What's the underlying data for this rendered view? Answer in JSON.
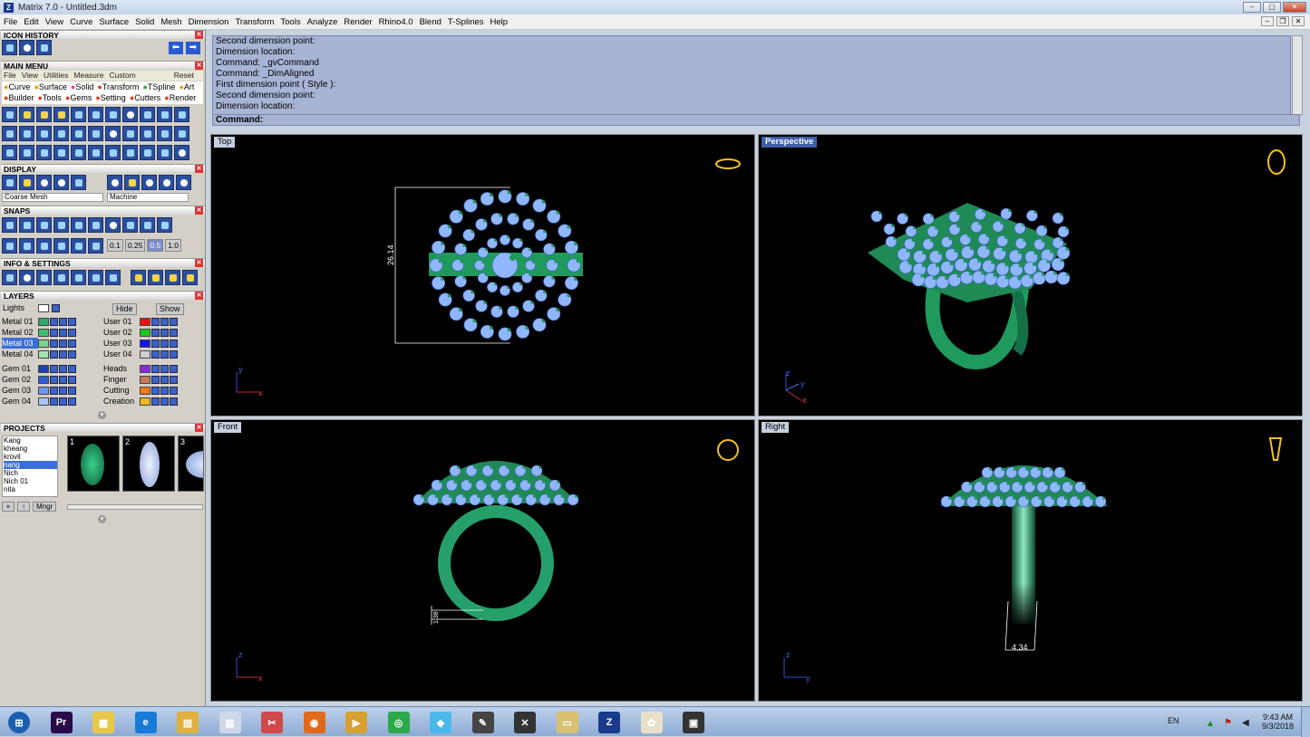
{
  "window": {
    "title": "Matrix 7.0 - Untitled.3dm",
    "app_icon": "Z"
  },
  "menu": [
    "File",
    "Edit",
    "View",
    "Curve",
    "Surface",
    "Solid",
    "Mesh",
    "Dimension",
    "Transform",
    "Tools",
    "Analyze",
    "Render",
    "Rhino4.0",
    "Blend",
    "T-Splines",
    "Help"
  ],
  "panels": {
    "icon_history": "ICON HISTORY",
    "main_menu": "MAIN MENU",
    "main_tabs": [
      "File",
      "View",
      "Utilities",
      "Measure",
      "Custom"
    ],
    "reset": "Reset",
    "sub_tabs_row1": [
      "Curve",
      "Surface",
      "Solid",
      "Transform",
      "TSpline",
      "Art"
    ],
    "sub_tabs_row2": [
      "Builder",
      "Tools",
      "Gems",
      "Setting",
      "Cutters",
      "Render"
    ],
    "display": "DISPLAY",
    "display_mesh": "Coarse Mesh",
    "display_machine": "Machine",
    "snaps": "SNAPS",
    "snap_values": [
      "0.1",
      "0.25",
      "0.5",
      "1.0"
    ],
    "info_settings": "INFO & SETTINGS",
    "layers": "LAYERS",
    "lights": "Lights",
    "hide": "Hide",
    "show": "Show",
    "metal_layers": [
      "Metal 01",
      "Metal 02",
      "Metal 03",
      "Metal 04"
    ],
    "metal_colors": [
      "#2fa66b",
      "#3fbf6e",
      "#7ad38e",
      "#a6e2b0"
    ],
    "user_layers": [
      "User 01",
      "User 02",
      "User 03",
      "User 04"
    ],
    "user_colors": [
      "#ee1111",
      "#18c818",
      "#1414e6",
      "#cfcfcf"
    ],
    "gem_layers": [
      "Gem 01",
      "Gem 02",
      "Gem 03",
      "Gem 04"
    ],
    "gem_colors": [
      "#1a3fb0",
      "#2f5cd8",
      "#6f95ee",
      "#a9c4f8"
    ],
    "other_layers": [
      "Heads",
      "Finger",
      "Cutting",
      "Creation"
    ],
    "other_colors": [
      "#8a2be2",
      "#c87858",
      "#f07a1a",
      "#f3b91a"
    ],
    "projects": "PROJECTS",
    "project_names": [
      "Kang",
      "kheang",
      "krovil",
      "nang",
      "Nich",
      "Nich 01",
      "nita"
    ],
    "project_thumbs": [
      "1",
      "2",
      "3"
    ],
    "mngr": "Mngr"
  },
  "command": {
    "history": [
      "Second dimension point:",
      "Dimension location:",
      "Command: _gvCommand",
      "Command: _DimAligned",
      "First dimension point ( Style ):",
      "Second dimension point:",
      "Dimension location:"
    ],
    "prompt": "Command:"
  },
  "viewports": [
    {
      "label": "Top",
      "active": false,
      "dimension": "26.14",
      "axes": [
        "y",
        "x"
      ]
    },
    {
      "label": "Perspective",
      "active": true,
      "axes": [
        "z",
        "y",
        "x"
      ]
    },
    {
      "label": "Front",
      "active": false,
      "dimension": "1.38",
      "axes": [
        "z",
        "x"
      ]
    },
    {
      "label": "Right",
      "active": false,
      "dimension": "4.34",
      "axes": [
        "z",
        "y"
      ]
    }
  ],
  "taskbar": {
    "apps": [
      "start-orb",
      "premiere-icon",
      "folder-icon",
      "ie-icon",
      "explorer-icon",
      "calculator-icon",
      "snipping-icon",
      "firefox-icon",
      "media-icon",
      "chrome-icon",
      "eraser-icon",
      "pen-icon",
      "zbrush-icon",
      "notes-icon",
      "matrix-icon",
      "paint-icon",
      "rhino-icon"
    ],
    "lang": "EN",
    "time": "9:43 AM",
    "date": "9/3/2018"
  },
  "colors": {
    "ring_metal": "#1f9a5c",
    "gem": "#8fb6ff",
    "viewport_bg": "#000000",
    "active_tab": "#3e5fa8"
  }
}
